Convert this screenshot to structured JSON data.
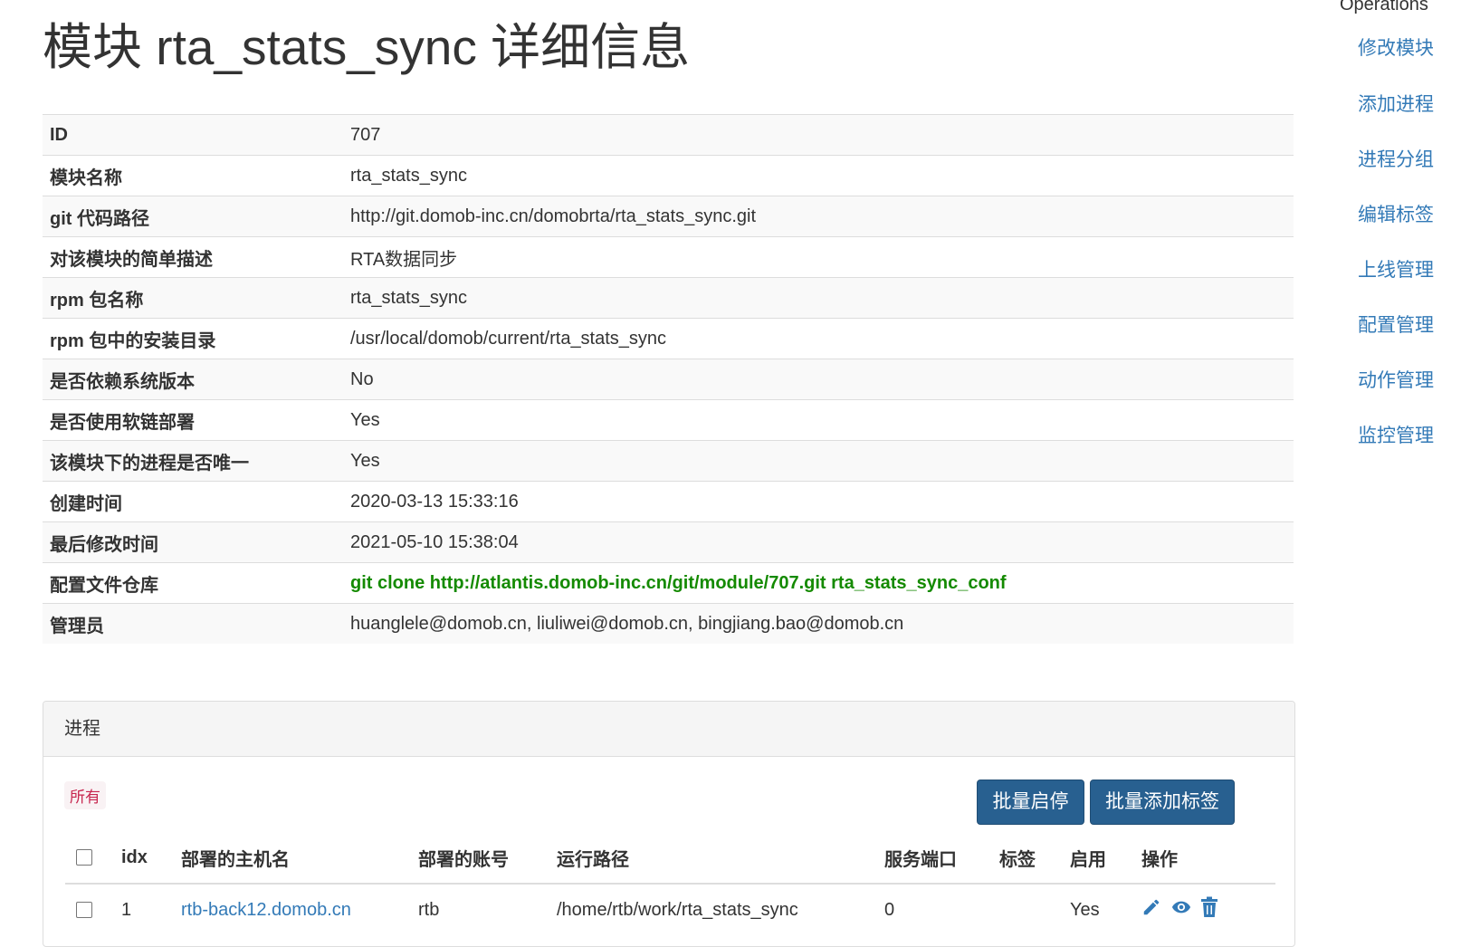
{
  "page": {
    "title": "模块 rta_stats_sync 详细信息"
  },
  "info": [
    {
      "label": "ID",
      "value": "707"
    },
    {
      "label": "模块名称",
      "value": "rta_stats_sync"
    },
    {
      "label": "git 代码路径",
      "value": "http://git.domob-inc.cn/domobrta/rta_stats_sync.git"
    },
    {
      "label": "对该模块的简单描述",
      "value": "RTA数据同步"
    },
    {
      "label": "rpm 包名称",
      "value": "rta_stats_sync"
    },
    {
      "label": "rpm 包中的安装目录",
      "value": "/usr/local/domob/current/rta_stats_sync"
    },
    {
      "label": "是否依赖系统版本",
      "value": "No"
    },
    {
      "label": "是否使用软链部署",
      "value": "Yes"
    },
    {
      "label": "该模块下的进程是否唯一",
      "value": "Yes"
    },
    {
      "label": "创建时间",
      "value": "2020-03-13 15:33:16"
    },
    {
      "label": "最后修改时间",
      "value": "2021-05-10 15:38:04"
    },
    {
      "label": "配置文件仓库",
      "value": "git clone http://atlantis.domob-inc.cn/git/module/707.git rta_stats_sync_conf"
    },
    {
      "label": "管理员",
      "value": "huanglele@domob.cn, liuliwei@domob.cn, bingjiang.bao@domob.cn"
    }
  ],
  "operations": {
    "title": "Operations",
    "links": [
      "修改模块",
      "添加进程",
      "进程分组",
      "编辑标签",
      "上线管理",
      "配置管理",
      "动作管理",
      "监控管理"
    ]
  },
  "process_panel": {
    "heading": "进程",
    "filter_tag": "所有",
    "batch_toggle_label": "批量启停",
    "batch_tag_label": "批量添加标签",
    "columns": [
      "idx",
      "部署的主机名",
      "部署的账号",
      "运行路径",
      "服务端口",
      "标签",
      "启用",
      "操作"
    ],
    "rows": [
      {
        "idx": "1",
        "host": "rtb-back12.domob.cn",
        "account": "rtb",
        "path": "/home/rtb/work/rta_stats_sync",
        "port": "0",
        "tags": "",
        "enabled": "Yes"
      }
    ]
  },
  "icons": {
    "edit": "pencil-icon",
    "view": "eye-icon",
    "delete": "trash-icon"
  },
  "colors": {
    "link": "#337ab7",
    "primary_button": "#286090",
    "config_repo_text": "#148a00",
    "tag_text": "#c7254e",
    "tag_bg": "#f9f2f4"
  }
}
